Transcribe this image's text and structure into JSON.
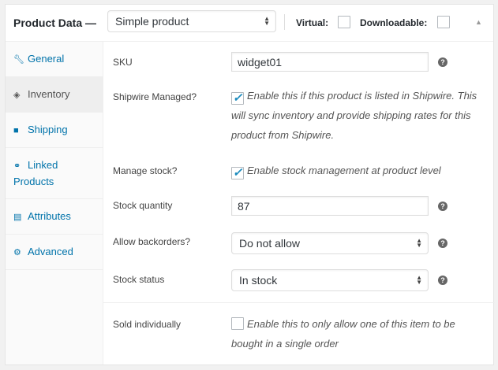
{
  "header": {
    "title": "Product Data —",
    "product_type": "Simple product",
    "virtual_label": "Virtual:",
    "virtual_checked": false,
    "downloadable_label": "Downloadable:",
    "downloadable_checked": false
  },
  "tabs": [
    {
      "label": "General",
      "icon": "wrench-icon"
    },
    {
      "label": "Inventory",
      "icon": "tag-icon",
      "active": true
    },
    {
      "label": "Shipping",
      "icon": "truck-icon"
    },
    {
      "label": "Linked Products",
      "icon": "link-icon"
    },
    {
      "label": "Attributes",
      "icon": "list-icon"
    },
    {
      "label": "Advanced",
      "icon": "gear-icon"
    }
  ],
  "fields": {
    "sku": {
      "label": "SKU",
      "value": "widget01"
    },
    "shipwire": {
      "label": "Shipwire Managed?",
      "checked": true,
      "desc": "Enable this if this product is listed in Shipwire. This will sync inventory and provide shipping rates for this product from Shipwire."
    },
    "manage_stock": {
      "label": "Manage stock?",
      "checked": true,
      "desc": "Enable stock management at product level"
    },
    "stock_qty": {
      "label": "Stock quantity",
      "value": "87"
    },
    "backorders": {
      "label": "Allow backorders?",
      "value": "Do not allow"
    },
    "stock_status": {
      "label": "Stock status",
      "value": "In stock"
    },
    "sold_individually": {
      "label": "Sold individually",
      "checked": false,
      "desc": "Enable this to only allow one of this item to be bought in a single order"
    }
  },
  "colors": {
    "accent": "#0073aa",
    "check": "#1e8cbe"
  }
}
